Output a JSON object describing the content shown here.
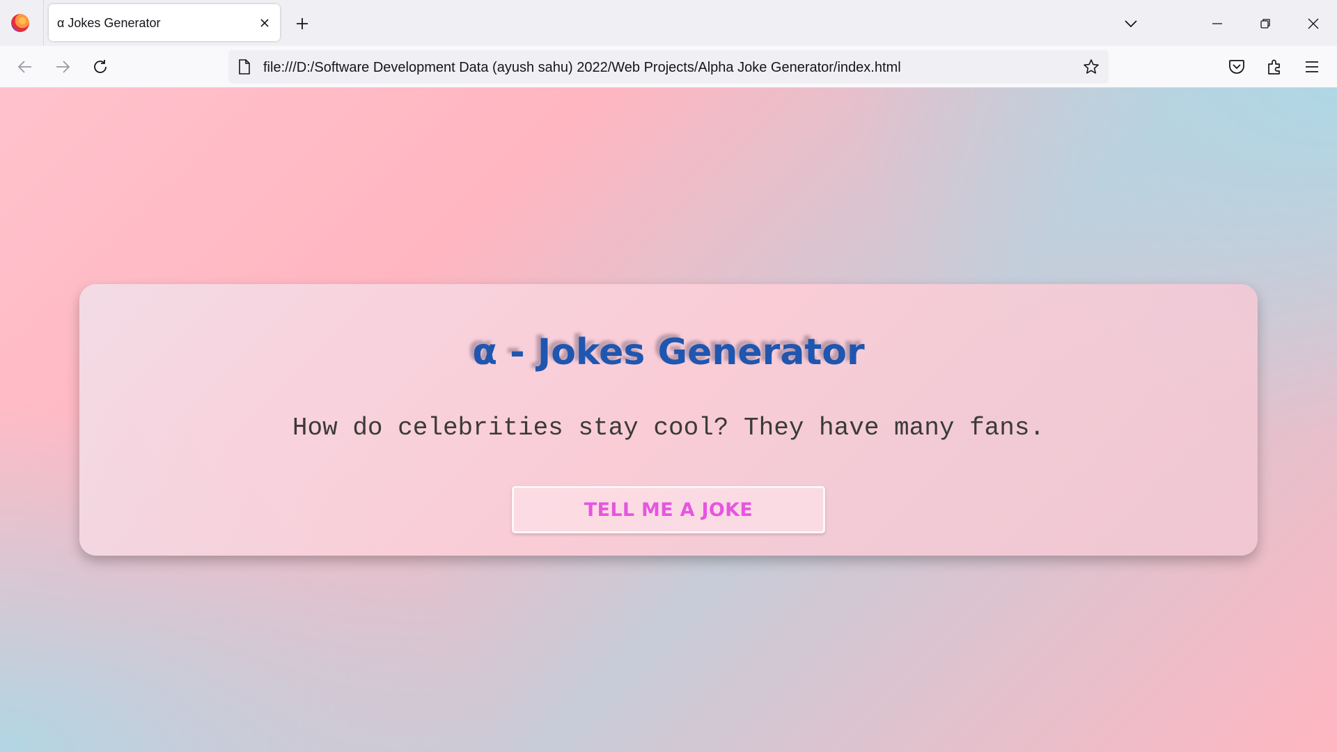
{
  "browser": {
    "tab": {
      "title": "α Jokes Generator"
    },
    "url": "file:///D:/Software Development Data (ayush sahu) 2022/Web Projects/Alpha Joke Generator/index.html",
    "icons": {
      "logo": "firefox-logo",
      "close_tab": "close-icon",
      "new_tab": "plus-icon",
      "tab_list": "chevron-down-icon",
      "back": "arrow-left-icon",
      "forward": "arrow-right-icon",
      "reload": "reload-icon",
      "page": "page-icon",
      "bookmark": "star-icon",
      "pocket": "pocket-icon",
      "extensions": "puzzle-icon",
      "menu": "hamburger-icon"
    }
  },
  "page": {
    "title": "α - Jokes Generator",
    "joke": "How do celebrities stay cool? They have many fans.",
    "button_label": "TELL ME A JOKE"
  },
  "colors": {
    "title": "#1f56b0",
    "button_text": "#e655e0",
    "gradient_pink": "#ffb6c1",
    "gradient_blue": "#add8e6"
  }
}
